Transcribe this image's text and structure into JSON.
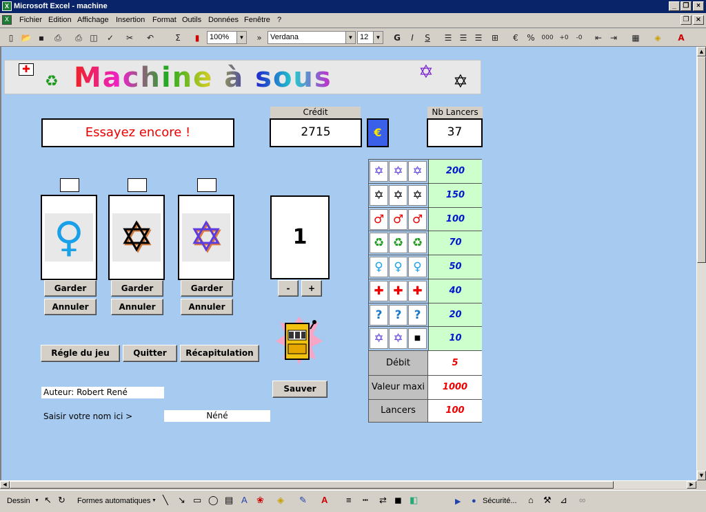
{
  "window": {
    "title": "Microsoft Excel - machine"
  },
  "menu": [
    "Fichier",
    "Edition",
    "Affichage",
    "Insertion",
    "Format",
    "Outils",
    "Données",
    "Fenêtre",
    "?"
  ],
  "toolbar": {
    "zoom": "100%",
    "font": "Verdana",
    "size": "12"
  },
  "game": {
    "title": "Machine à sous",
    "message": "Essayez encore !",
    "credit_label": "Crédit",
    "credit_value": "2715",
    "currency": "€",
    "launches_label": "Nb Lancers",
    "launches_value": "37",
    "reels": [
      {
        "symbol": "female-sign",
        "glyph": "♀"
      },
      {
        "symbol": "star-of-david-white",
        "glyph": "✡"
      },
      {
        "symbol": "star-of-david-blue",
        "glyph": "✡"
      }
    ],
    "keep_label": "Garder",
    "cancel_label": "Annuler",
    "bet_value": "1",
    "minus_label": "-",
    "plus_label": "+",
    "rules_button": "Régle du jeu",
    "quit_button": "Quitter",
    "recap_button": "Récapitulation",
    "save_button": "Sauver",
    "author_label": "Auteur: Robert René",
    "name_prompt": "Saisir votre nom ici >",
    "name_value": "Néné"
  },
  "paytable": [
    {
      "symbols": [
        "✡",
        "✡",
        "✡"
      ],
      "icon": "star-of-david-blue",
      "payout": "200"
    },
    {
      "symbols": [
        "✡",
        "✡",
        "✡"
      ],
      "icon": "star-of-david-white",
      "payout": "150"
    },
    {
      "symbols": [
        "♂",
        "♂",
        "♂"
      ],
      "icon": "male-sign",
      "payout": "100"
    },
    {
      "symbols": [
        "♻",
        "♻",
        "♻"
      ],
      "icon": "recycle",
      "payout": "70"
    },
    {
      "symbols": [
        "♀",
        "♀",
        "♀"
      ],
      "icon": "female-sign",
      "payout": "50"
    },
    {
      "symbols": [
        "✚",
        "✚",
        "✚"
      ],
      "icon": "red-cross",
      "payout": "40"
    },
    {
      "symbols": [
        "?",
        "?",
        "?"
      ],
      "icon": "question",
      "payout": "20"
    },
    {
      "symbols": [
        "✡",
        "✡",
        "■"
      ],
      "icon": "star-of-david-blue",
      "payout": "10"
    }
  ],
  "stats": [
    {
      "label": "Débit",
      "value": "5"
    },
    {
      "label": "Valeur maxi",
      "value": "1000"
    },
    {
      "label": "Lancers",
      "value": "100"
    }
  ],
  "drawbar": {
    "dessin": "Dessin",
    "formes": "Formes automatiques",
    "securite": "Sécurité..."
  }
}
